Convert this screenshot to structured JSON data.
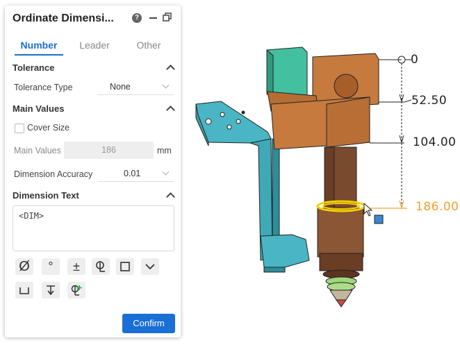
{
  "dialog": {
    "title": "Ordinate Dimensi...",
    "help_glyph": "?"
  },
  "tabs": [
    {
      "label": "Number"
    },
    {
      "label": "Leader"
    },
    {
      "label": "Other"
    }
  ],
  "tolerance": {
    "header": "Tolerance",
    "type_label": "Tolerance Type",
    "type_value": "None"
  },
  "main_values": {
    "header": "Main Values",
    "cover_size_label": "Cover Size",
    "main_values_label": "Main Values",
    "main_values_value": "186",
    "unit": "mm",
    "accuracy_label": "Dimension Accuracy",
    "accuracy_value": "0.01"
  },
  "dimension_text": {
    "header": "Dimension Text",
    "value": "<DIM>"
  },
  "symbols": {
    "diameter": "Ø",
    "degree": "°",
    "plus_minus": "±"
  },
  "confirm_label": "Confirm",
  "viewport": {
    "dimensions": [
      {
        "label": "0"
      },
      {
        "label": "52.50"
      },
      {
        "label": "104.00"
      },
      {
        "label": "186.00"
      }
    ],
    "active_color": "#f0a030",
    "accent_color": "#1a6fd6"
  }
}
